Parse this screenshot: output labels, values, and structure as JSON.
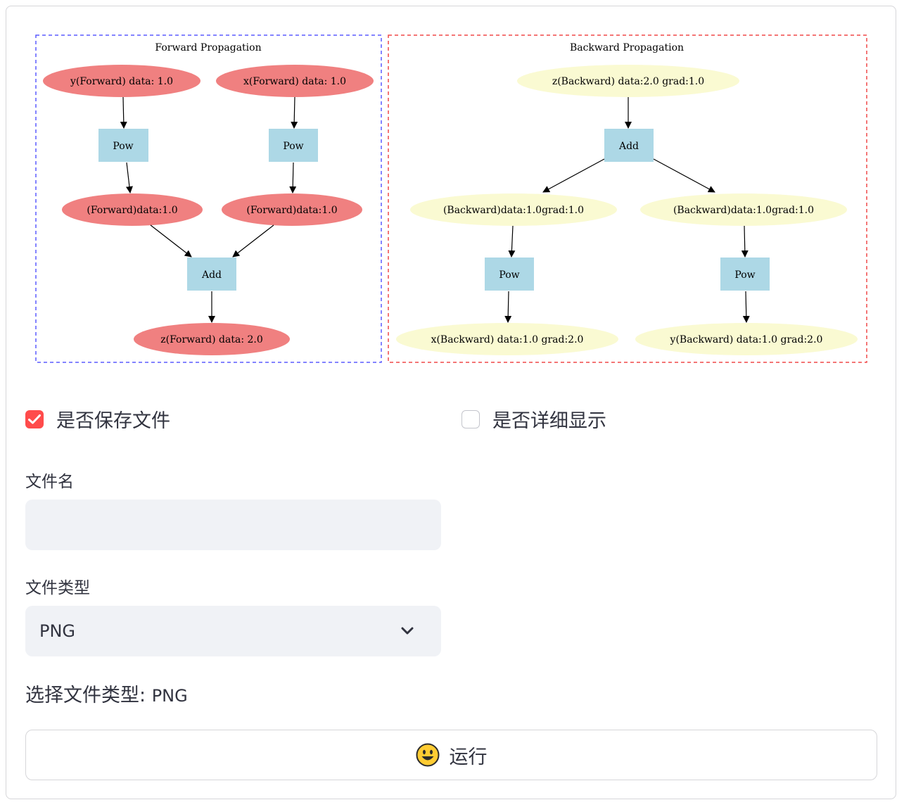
{
  "graph": {
    "forward": {
      "title": "Forward Propagation",
      "nodes": {
        "y_in": "y(Forward) data: 1.0",
        "x_in": "x(Forward) data: 1.0",
        "pow_left": "Pow",
        "pow_right": "Pow",
        "mid_left": "(Forward)data:1.0",
        "mid_right": "(Forward)data:1.0",
        "add": "Add",
        "z_out": "z(Forward) data: 2.0"
      },
      "colors": {
        "border": "#5b5bff",
        "ellipse": "#f08080",
        "op": "#add8e6"
      }
    },
    "backward": {
      "title": "Backward Propagation",
      "nodes": {
        "z_in": "z(Backward) data:2.0 grad:1.0",
        "add": "Add",
        "mid_left": "(Backward)data:1.0grad:1.0",
        "mid_right": "(Backward)data:1.0grad:1.0",
        "pow_left": "Pow",
        "pow_right": "Pow",
        "x_out": "x(Backward) data:1.0 grad:2.0",
        "y_out": "y(Backward) data:1.0 grad:2.0"
      },
      "colors": {
        "border": "#f04848",
        "ellipse": "#fafad2",
        "op": "#add8e6"
      }
    }
  },
  "options": {
    "save_file": {
      "label": "是否保存文件",
      "checked": true
    },
    "verbose": {
      "label": "是否详细显示",
      "checked": false
    }
  },
  "filename": {
    "label": "文件名",
    "value": "",
    "placeholder": ""
  },
  "filetype": {
    "label": "文件类型",
    "selected": "PNG",
    "icon": "chevron-down-icon"
  },
  "result": {
    "prefix": "选择文件类型: ",
    "value": "PNG"
  },
  "run_button": {
    "label": "运行",
    "icon": "smiley-emoji-icon"
  },
  "theme": {
    "accent": "#ff4b4b",
    "input_bg": "#f0f2f6",
    "text": "#31333f"
  }
}
